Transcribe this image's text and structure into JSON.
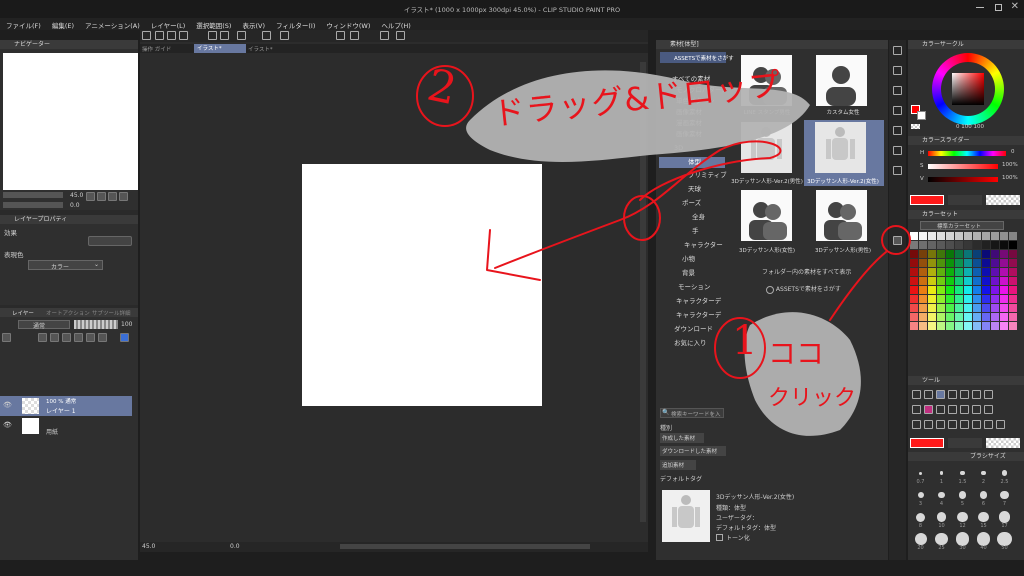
{
  "window": {
    "title": "イラスト* (1000 x 1000px 300dpi 45.0%) - CLIP STUDIO PAINT PRO"
  },
  "menu": [
    "ファイル(F)",
    "編集(E)",
    "アニメーション(A)",
    "レイヤー(L)",
    "選択範囲(S)",
    "表示(V)",
    "フィルター(I)",
    "ウィンドウ(W)",
    "ヘルプ(H)"
  ],
  "tabs": [
    "操作 ガイド",
    "イラスト*",
    "イラスト*"
  ],
  "navigator": {
    "zoom": "45.0",
    "rotate": "0.0",
    "title": "ナビゲーター"
  },
  "layer_property": {
    "title": "レイヤープロパティ",
    "effect_label": "効果",
    "color_label": "表現色",
    "color_value": "カラー"
  },
  "layer_panel": {
    "tabs": [
      "レイヤー",
      "オートアクション",
      "サブツール詳細"
    ],
    "blend_mode": "通常",
    "opacity": "100",
    "layers": [
      {
        "meta": "100 % 通常",
        "name": "レイヤー 1"
      },
      {
        "meta": "",
        "name": "用紙"
      }
    ]
  },
  "statusbar": {
    "zoom": "45.0",
    "angle": "0.0"
  },
  "material": {
    "title": "素材[体型]",
    "assets_button": "ASSETSで素材をさがす",
    "tree": [
      "すべての素材",
      "モノクロパターン",
      "単色パターン",
      "画像素材",
      "漫画素材",
      "画像素材",
      "3D",
      "体型",
      "プリミティブ",
      "天球",
      "ポーズ",
      "全身",
      "手",
      "キャラクター",
      "小物",
      "背景",
      "モーション",
      "キャラクターデ",
      "キャラクターデ",
      "ダウンロード",
      "お気に入り"
    ],
    "grid": [
      {
        "caption": "LINE スタンプ男性"
      },
      {
        "caption": "カスタム女性"
      },
      {
        "caption": "3Dデッサン人形-Ver.2(男性)"
      },
      {
        "caption": "3Dデッサン人形-Ver.2(女性)"
      },
      {
        "caption": "3Dデッサン人形(女性)"
      },
      {
        "caption": "3Dデッサン人形(男性)"
      }
    ],
    "show_all": "フォルダー内の素材をすべて表示",
    "assets_link": "ASSETSで素材をさがす",
    "search_placeholder": "検索キーワードを入",
    "type_label": "種別",
    "type_buttons": [
      "作成した素材",
      "ダウンロードした素材",
      "追加素材"
    ],
    "default_tag": "デフォルトタグ",
    "detail": {
      "name": "3Dデッサン人形-Ver.2(女性)",
      "kind": "種類：体型",
      "user_tag": "ユーザータグ：",
      "default_tag": "デフォルトタグ：体型",
      "tone": "トーン化"
    }
  },
  "color_wheel": {
    "title": "カラーサークル",
    "h": "0",
    "s": "100",
    "v": "100"
  },
  "color_slider": {
    "title": "カラースライダー",
    "values": [
      "0",
      "100%",
      "100%"
    ],
    "labels": [
      "H",
      "S",
      "V"
    ]
  },
  "color_set": {
    "title": "カラーセット",
    "name": "標準カラーセット"
  },
  "tool_panel": {
    "title": "ツール"
  },
  "brush_size": {
    "title": "ブラシサイズ",
    "sizes": [
      "0.7",
      "1",
      "1.5",
      "2",
      "2.5",
      "3",
      "4",
      "5",
      "6",
      "7",
      "8",
      "10",
      "12",
      "15",
      "17",
      "20",
      "25",
      "30",
      "40",
      "50"
    ]
  },
  "annotations": {
    "step2_num": "2",
    "step2_text": "ドラッグ&ドロップ",
    "step1_num": "1",
    "step1_line1": "ココ",
    "step1_line2": "クリック"
  },
  "colors": {
    "accent_red": "#e8141c",
    "fg_color": "#ff0000",
    "selected_blue": "#6878a0"
  }
}
